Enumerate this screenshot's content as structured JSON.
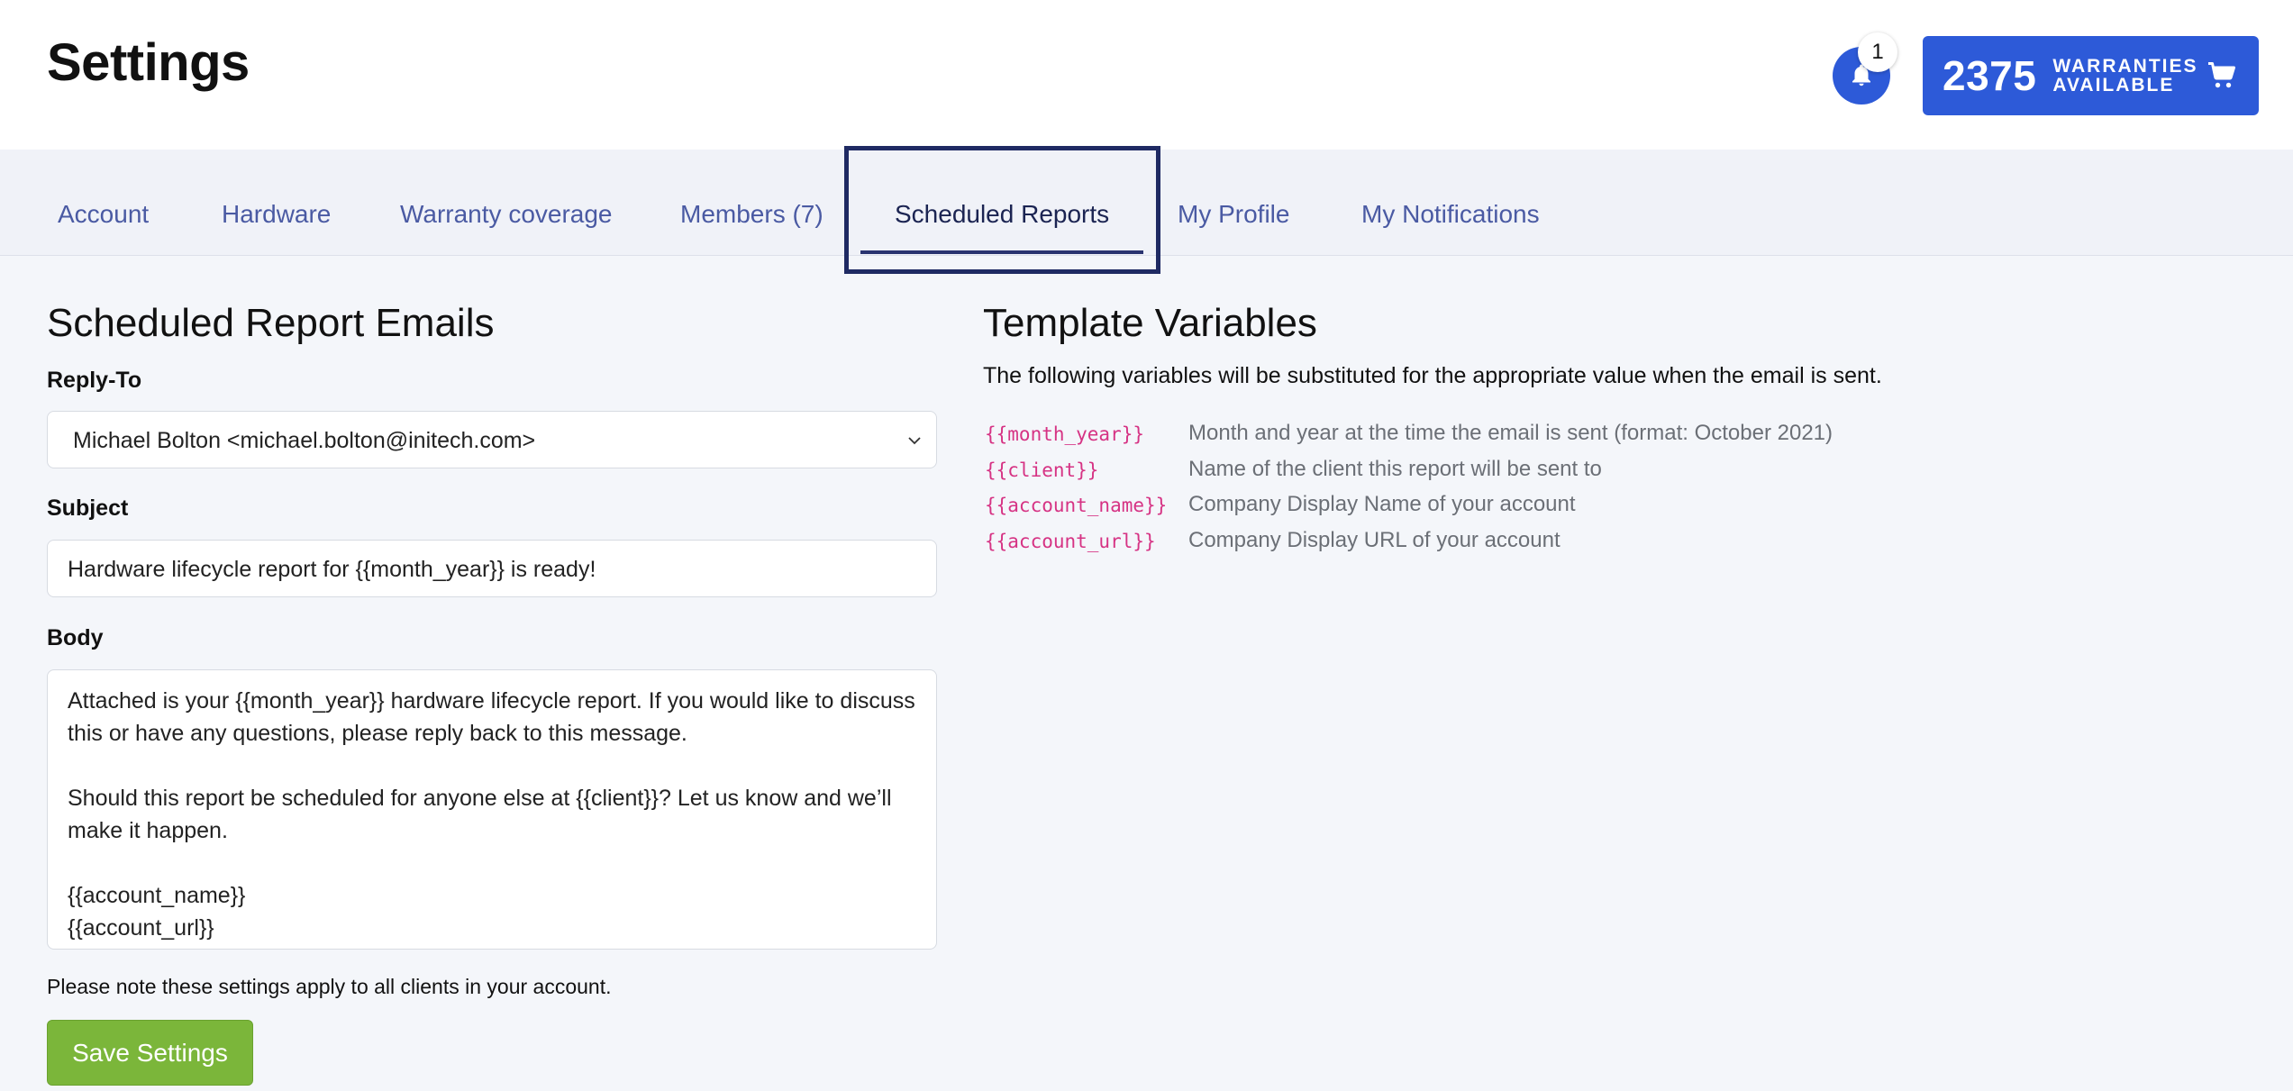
{
  "header": {
    "title": "Settings",
    "notification_count": "1",
    "warranty_count": "2375",
    "warranty_label_line1": "WARRANTIES",
    "warranty_label_line2": "AVAILABLE"
  },
  "tabs": [
    {
      "label": "Account",
      "active": false
    },
    {
      "label": "Hardware",
      "active": false
    },
    {
      "label": "Warranty coverage",
      "active": false
    },
    {
      "label": "Members (7)",
      "active": false
    },
    {
      "label": "Scheduled Reports",
      "active": true
    },
    {
      "label": "My Profile",
      "active": false
    },
    {
      "label": "My Notifications",
      "active": false
    }
  ],
  "left": {
    "title": "Scheduled Report Emails",
    "reply_to_label": "Reply-To",
    "reply_to_value": "Michael Bolton <michael.bolton@initech.com>",
    "subject_label": "Subject",
    "subject_value": "Hardware lifecycle report for {{month_year}} is ready!",
    "body_label": "Body",
    "body_value": "Attached is your {{month_year}} hardware lifecycle report. If you would like to discuss this or have any questions, please reply back to this message.\n\nShould this report be scheduled for anyone else at {{client}}? Let us know and we’ll make it happen.\n\n{{account_name}}\n{{account_url}}",
    "note": "Please note these settings apply to all clients in your account.",
    "save_label": "Save Settings"
  },
  "right": {
    "title": "Template Variables",
    "description": "The following variables will be substituted for the appropriate value when the email is sent.",
    "variables": [
      {
        "code": "{{month_year}}",
        "desc": "Month and year at the time the email is sent (format: October 2021)"
      },
      {
        "code": "{{client}}",
        "desc": "Name of the client this report will be sent to"
      },
      {
        "code": "{{account_name}}",
        "desc": "Company Display Name of your account"
      },
      {
        "code": "{{account_url}}",
        "desc": "Company Display URL of your account"
      }
    ]
  },
  "colors": {
    "accent": "#2d5ad8",
    "save_button": "#7bb63a",
    "variable_code": "#d63384",
    "tab_text": "#4a5aa3"
  }
}
